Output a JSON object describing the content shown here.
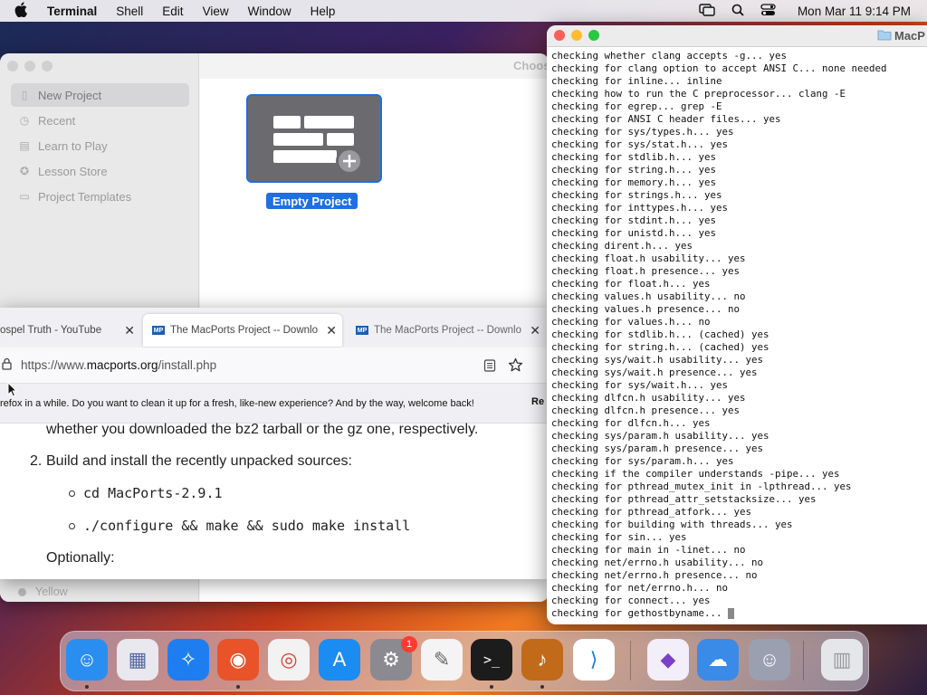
{
  "menubar": {
    "app": "Terminal",
    "items": [
      "Shell",
      "Edit",
      "View",
      "Window",
      "Help"
    ],
    "clock": "Mon Mar 11  9:14 PM"
  },
  "playgrounds": {
    "title_partial": "Choos",
    "sidebar": [
      {
        "label": "New Project",
        "icon": "doc-icon"
      },
      {
        "label": "Recent",
        "icon": "clock-icon"
      },
      {
        "label": "Learn to Play",
        "icon": "book-icon"
      },
      {
        "label": "Lesson Store",
        "icon": "star-icon"
      },
      {
        "label": "Project Templates",
        "icon": "folder-icon"
      }
    ],
    "template_label": "Empty Project",
    "behind_item": "Yellow"
  },
  "browser": {
    "tabs": [
      {
        "label": "ospel Truth - YouTube"
      },
      {
        "label": "The MacPorts Project -- Downlo"
      },
      {
        "label": "The MacPorts Project -- Downlo"
      }
    ],
    "url_prefix": "https://www.",
    "url_domain": "macports.org",
    "url_path": "/install.php",
    "notice": "refox in a while. Do you want to clean it up for a fresh, like-new experience? And by the way, welcome back!",
    "notice_button": "Re",
    "content": {
      "line_top": "whether you downloaded the bz2 tarball or the gz one, respectively.",
      "step_number": "2.",
      "step_text": "Build and install the recently unpacked sources:",
      "bullets": [
        "cd MacPorts-2.9.1",
        "./configure && make && sudo make install"
      ],
      "optionally": "Optionally:"
    }
  },
  "terminal": {
    "title_partial": "MacP",
    "lines": [
      "checking whether clang accepts -g... yes",
      "checking for clang option to accept ANSI C... none needed",
      "checking for inline... inline",
      "checking how to run the C preprocessor... clang -E",
      "checking for egrep... grep -E",
      "checking for ANSI C header files... yes",
      "checking for sys/types.h... yes",
      "checking for sys/stat.h... yes",
      "checking for stdlib.h... yes",
      "checking for string.h... yes",
      "checking for memory.h... yes",
      "checking for strings.h... yes",
      "checking for inttypes.h... yes",
      "checking for stdint.h... yes",
      "checking for unistd.h... yes",
      "checking dirent.h... yes",
      "checking float.h usability... yes",
      "checking float.h presence... yes",
      "checking for float.h... yes",
      "checking values.h usability... no",
      "checking values.h presence... no",
      "checking for values.h... no",
      "checking for stdlib.h... (cached) yes",
      "checking for string.h... (cached) yes",
      "checking sys/wait.h usability... yes",
      "checking sys/wait.h presence... yes",
      "checking for sys/wait.h... yes",
      "checking dlfcn.h usability... yes",
      "checking dlfcn.h presence... yes",
      "checking for dlfcn.h... yes",
      "checking sys/param.h usability... yes",
      "checking sys/param.h presence... yes",
      "checking for sys/param.h... yes",
      "checking if the compiler understands -pipe... yes",
      "checking for pthread_mutex_init in -lpthread... yes",
      "checking for pthread_attr_setstacksize... yes",
      "checking for pthread_atfork... yes",
      "checking for building with threads... yes",
      "checking for sin... yes",
      "checking for main in -linet... no",
      "checking net/errno.h usability... no",
      "checking net/errno.h presence... no",
      "checking for net/errno.h... no",
      "checking for connect... yes",
      "checking for gethostbyname... "
    ]
  },
  "dock": {
    "badge": "1",
    "apps": [
      {
        "icon": "finder-icon",
        "color": "#2a8ef0"
      },
      {
        "icon": "launchpad-icon",
        "color": "#e8e8ee"
      },
      {
        "icon": "safari-icon",
        "color": "#1e7ef0"
      },
      {
        "icon": "firefox-icon",
        "color": "#e8532a"
      },
      {
        "icon": "chrome-icon",
        "color": "#f2f2f2"
      },
      {
        "icon": "app-store-icon",
        "color": "#1a8cf2"
      },
      {
        "icon": "system-settings-icon",
        "color": "#8a8a90"
      },
      {
        "icon": "textedit-icon",
        "color": "#f4f4f4"
      },
      {
        "icon": "terminal-icon",
        "color": "#1c1c1c"
      },
      {
        "icon": "garageband-icon",
        "color": "#c06a1a"
      },
      {
        "icon": "vscode-icon",
        "color": "#ffffff"
      },
      {
        "icon": "visual-studio-icon",
        "color": "#f2eefa"
      },
      {
        "icon": "weather-icon",
        "color": "#3a8ae8"
      },
      {
        "icon": "migration-assistant-icon",
        "color": "#9aa0b0"
      },
      {
        "icon": "trash-icon",
        "color": "#e4e6ea"
      }
    ]
  }
}
